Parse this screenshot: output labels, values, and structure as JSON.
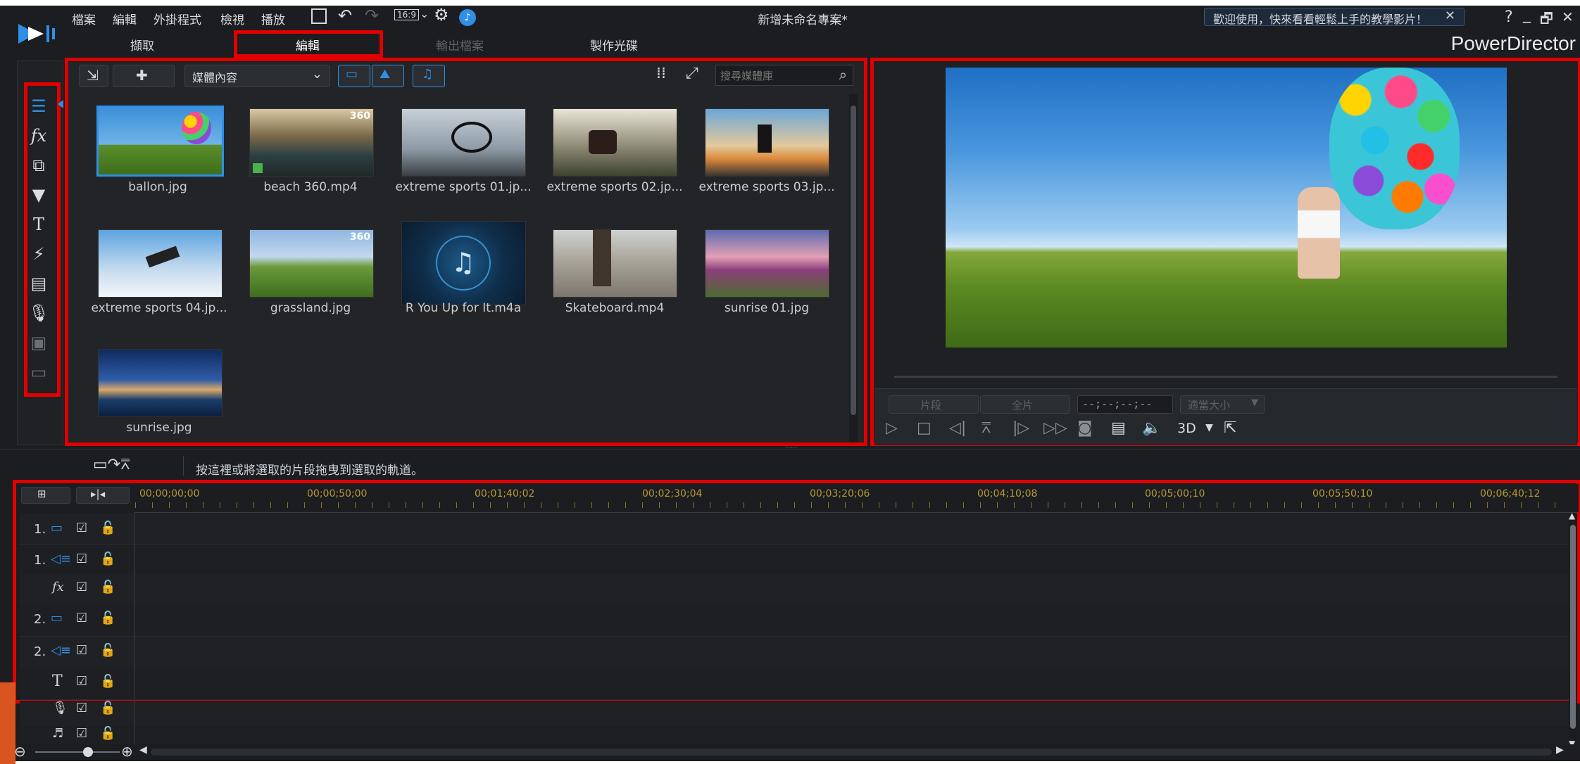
{
  "menu": [
    "檔案",
    "編輯",
    "外掛程式",
    "檢視",
    "播放"
  ],
  "window_title": "新增未命名專案*",
  "welcome_banner": "歡迎使用，快來看看輕鬆上手的教學影片！",
  "window_controls": {
    "help": "?",
    "minimize": "_",
    "restore": "🗗",
    "close": "✕"
  },
  "aspect_ratio": "16:9",
  "brand": "PowerDirector",
  "tabs": [
    {
      "label": "擷取",
      "active": false
    },
    {
      "label": "編輯",
      "active": true
    },
    {
      "label": "輸出檔案",
      "active": false,
      "disabled": true
    },
    {
      "label": "製作光碟",
      "active": false
    }
  ],
  "library": {
    "dropdown": "媒體內容",
    "search_placeholder": "搜尋媒體庫",
    "items": [
      {
        "name": "ballon.jpg",
        "badge": ""
      },
      {
        "name": "beach 360.mp4",
        "badge": "360"
      },
      {
        "name": "extreme sports 01.jp...",
        "badge": ""
      },
      {
        "name": "extreme sports 02.jp...",
        "badge": ""
      },
      {
        "name": "extreme sports 03.jp...",
        "badge": ""
      },
      {
        "name": "extreme sports 04.jp...",
        "badge": ""
      },
      {
        "name": "grassland.jpg",
        "badge": "360"
      },
      {
        "name": "R You Up for It.m4a",
        "badge": ""
      },
      {
        "name": "Skateboard.mp4",
        "badge": ""
      },
      {
        "name": "sunrise 01.jpg",
        "badge": ""
      },
      {
        "name": "sunrise.jpg",
        "badge": ""
      }
    ]
  },
  "preview": {
    "clip_btn": "片段",
    "movie_btn": "全片",
    "timecode": "--;--;--;--",
    "fit_size": "適當大小",
    "mode_3d": "3D"
  },
  "timeline": {
    "hint": "按這裡或將選取的片段拖曳到選取的軌道。",
    "ruler": [
      "00;00;00;00",
      "00;00;50;00",
      "00;01;40;02",
      "00;02;30;04",
      "00;03;20;06",
      "00;04;10;08",
      "00;05;00;10",
      "00;05;50;10",
      "00;06;40;12"
    ],
    "tracks": [
      {
        "label": "1.",
        "type": "video"
      },
      {
        "label": "1.",
        "type": "audio"
      },
      {
        "label": "fx",
        "type": "fx"
      },
      {
        "label": "2.",
        "type": "video"
      },
      {
        "label": "2.",
        "type": "audio"
      },
      {
        "label": "T",
        "type": "title"
      },
      {
        "label": "",
        "type": "voice"
      },
      {
        "label": "",
        "type": "music"
      }
    ]
  },
  "colors": {
    "accent": "#2f8fe6",
    "highlight": "#e00000",
    "bg": "#1b1d20",
    "panel": "#232529"
  }
}
